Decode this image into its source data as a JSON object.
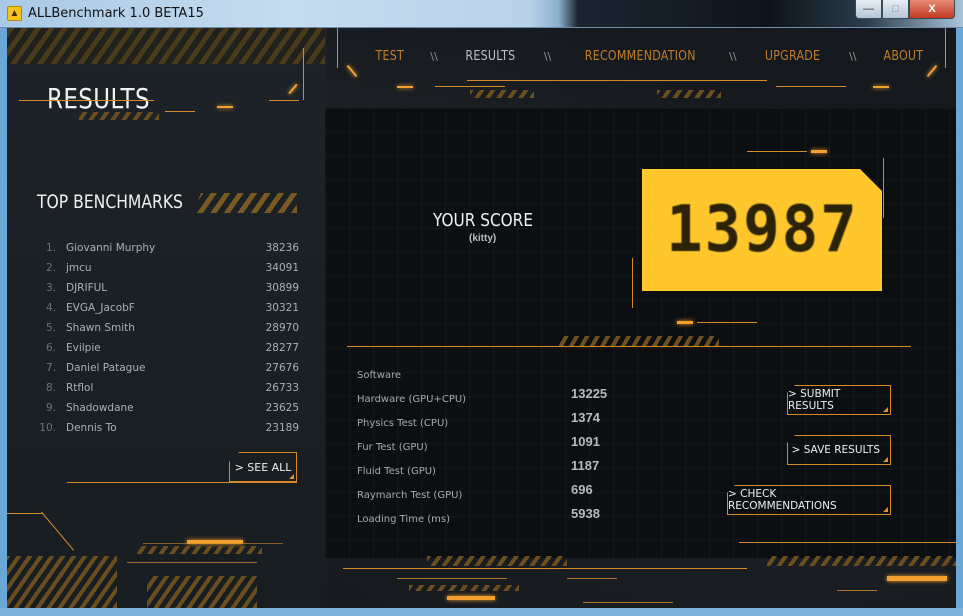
{
  "window": {
    "title": "ALLBenchmark 1.0 BETA15",
    "icon": "app-warning-icon",
    "controls": {
      "minimize": "—",
      "maximize": "□",
      "close": "X"
    }
  },
  "nav": {
    "items": [
      {
        "label": "TEST",
        "active": false
      },
      {
        "label": "RESULTS",
        "active": true
      },
      {
        "label": "RECOMMENDATION",
        "active": false
      },
      {
        "label": "UPGRADE",
        "active": false
      },
      {
        "label": "ABOUT",
        "active": false
      }
    ],
    "separator": "\\\\"
  },
  "sidebar": {
    "page_title": "RESULTS",
    "section_title": "TOP BENCHMARKS",
    "leaderboard": [
      {
        "rank": "1.",
        "name": "Giovanni Murphy",
        "score": "38236"
      },
      {
        "rank": "2.",
        "name": "jmcu",
        "score": "34091"
      },
      {
        "rank": "3.",
        "name": "DJRIFUL",
        "score": "30899"
      },
      {
        "rank": "4.",
        "name": "EVGA_JacobF",
        "score": "30321"
      },
      {
        "rank": "5.",
        "name": "Shawn Smith",
        "score": "28970"
      },
      {
        "rank": "6.",
        "name": "Evilpie",
        "score": "28277"
      },
      {
        "rank": "7.",
        "name": "Daniel Patague",
        "score": "27676"
      },
      {
        "rank": "8.",
        "name": "Rtflol",
        "score": "26733"
      },
      {
        "rank": "9.",
        "name": "Shadowdane",
        "score": "23625"
      },
      {
        "rank": "10.",
        "name": "Dennis To",
        "score": "23189"
      }
    ],
    "see_all_label": "> SEE ALL"
  },
  "score": {
    "heading": "YOUR SCORE",
    "user": "(kitty)",
    "value": "13987"
  },
  "stats": [
    {
      "label": "Software",
      "value": ""
    },
    {
      "label": "Hardware (GPU+CPU)",
      "value": "13225"
    },
    {
      "label": "Physics Test (CPU)",
      "value": "1374"
    },
    {
      "label": "Fur Test (GPU)",
      "value": "1091"
    },
    {
      "label": "Fluid Test (GPU)",
      "value": "1187"
    },
    {
      "label": "Raymarch Test (GPU)",
      "value": "696"
    },
    {
      "label": "Loading Time (ms)",
      "value": "5938"
    }
  ],
  "actions": {
    "submit": "> SUBMIT RESULTS",
    "save": "> SAVE RESULTS",
    "check": "> CHECK RECOMMENDATIONS"
  },
  "colors": {
    "accent": "#d68a2a",
    "score_box": "#ffc72c",
    "background": "#15191d"
  }
}
